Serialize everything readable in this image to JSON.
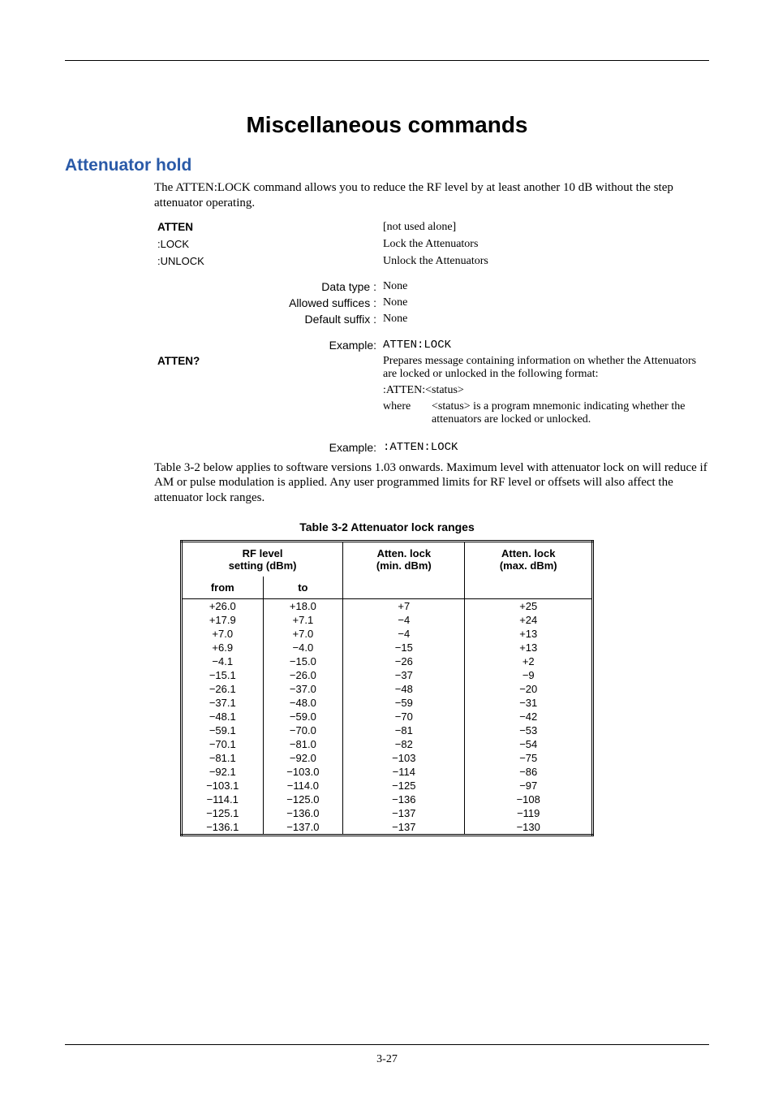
{
  "page_number": "3-27",
  "title": "Miscellaneous commands",
  "section": "Attenuator hold",
  "intro": "The ATTEN:LOCK command allows you to reduce the RF level by at least another 10 dB without the step attenuator operating.",
  "cmd": {
    "atten": "ATTEN",
    "atten_desc": "[not used alone]",
    "lock": ":LOCK",
    "lock_desc": "Lock the Attenuators",
    "unlock": ":UNLOCK",
    "unlock_desc": "Unlock the Attenuators",
    "datatype_label": "Data type :",
    "datatype_val": "None",
    "suffices_label": "Allowed suffices :",
    "suffices_val": "None",
    "default_label": "Default suffix :",
    "default_val": "None",
    "example_label": "Example:",
    "example_val1": "ATTEN:LOCK",
    "atten_q": "ATTEN?",
    "atten_q_desc": "Prepares message containing information on whether the Attenuators are locked or unlocked in the following format:",
    "atten_q_fmt": ":ATTEN:<status>",
    "where_label": "where",
    "where_desc": "<status> is a program mnemonic indicating whether the attenuators are locked or unlocked.",
    "example_val2": ":ATTEN:LOCK"
  },
  "note": "Table 3-2 below applies to software versions 1.03 onwards.  Maximum level with attenuator lock on will reduce if AM or pulse modulation is applied.  Any user programmed limits for RF level or offsets will also affect the attenuator lock ranges.",
  "table_caption": "Table 3-2  Attenuator lock ranges",
  "table_headers": {
    "rf": "RF level\nsetting (dBm)",
    "from": "from",
    "to": "to",
    "min": "Atten. lock\n(min. dBm)",
    "max": "Atten. lock\n(max. dBm)"
  },
  "chart_data": {
    "type": "table",
    "columns": [
      "from",
      "to",
      "min",
      "max"
    ],
    "rows": [
      [
        "+26.0",
        "+18.0",
        "+7",
        "+25"
      ],
      [
        "+17.9",
        "+7.1",
        "−4",
        "+24"
      ],
      [
        "+7.0",
        "+7.0",
        "−4",
        "+13"
      ],
      [
        "+6.9",
        "−4.0",
        "−15",
        "+13"
      ],
      [
        "−4.1",
        "−15.0",
        "−26",
        "+2"
      ],
      [
        "−15.1",
        "−26.0",
        "−37",
        "−9"
      ],
      [
        "−26.1",
        "−37.0",
        "−48",
        "−20"
      ],
      [
        "−37.1",
        "−48.0",
        "−59",
        "−31"
      ],
      [
        "−48.1",
        "−59.0",
        "−70",
        "−42"
      ],
      [
        "−59.1",
        "−70.0",
        "−81",
        "−53"
      ],
      [
        "−70.1",
        "−81.0",
        "−82",
        "−54"
      ],
      [
        "−81.1",
        "−92.0",
        "−103",
        "−75"
      ],
      [
        "−92.1",
        "−103.0",
        "−114",
        "−86"
      ],
      [
        "−103.1",
        "−114.0",
        "−125",
        "−97"
      ],
      [
        "−114.1",
        "−125.0",
        "−136",
        "−108"
      ],
      [
        "−125.1",
        "−136.0",
        "−137",
        "−119"
      ],
      [
        "−136.1",
        "−137.0",
        "−137",
        "−130"
      ]
    ]
  }
}
